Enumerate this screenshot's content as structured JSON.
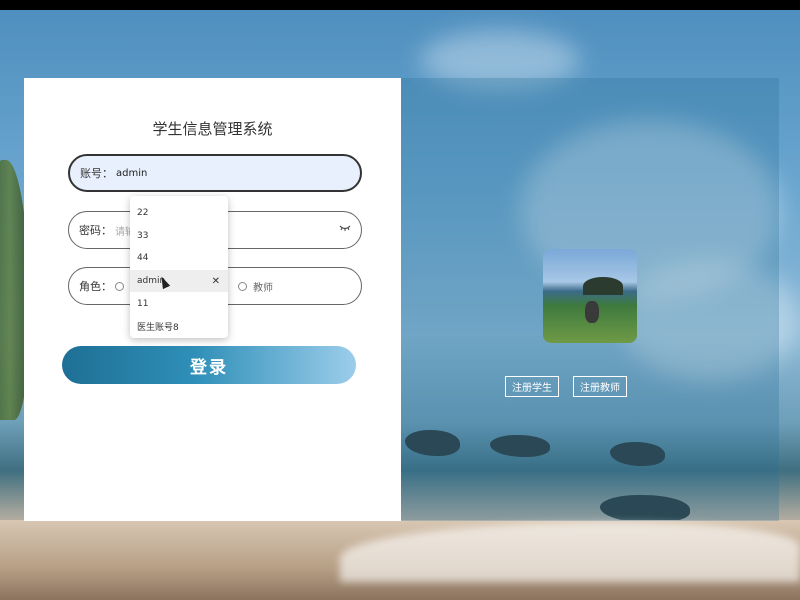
{
  "login": {
    "title": "学生信息管理系统",
    "username_label": "账号：",
    "username_value": "admin",
    "password_label": "密码：",
    "password_placeholder": "请输",
    "role_label": "角色：",
    "role_teacher": "教师",
    "submit_label": "登录"
  },
  "autocomplete": {
    "options": [
      "22",
      "33",
      "44",
      "admin",
      "11",
      "医生账号8"
    ],
    "highlighted_index": 3
  },
  "side": {
    "register_student": "注册学生",
    "register_teacher": "注册教师"
  },
  "icons": {
    "eye": "eye-closed-icon",
    "clear": "close-icon",
    "cursor": "mouse-pointer-icon"
  },
  "colors": {
    "button_start": "#1e6f95",
    "button_end": "#9ccdea",
    "active_field_bg": "#e8f0fe"
  }
}
